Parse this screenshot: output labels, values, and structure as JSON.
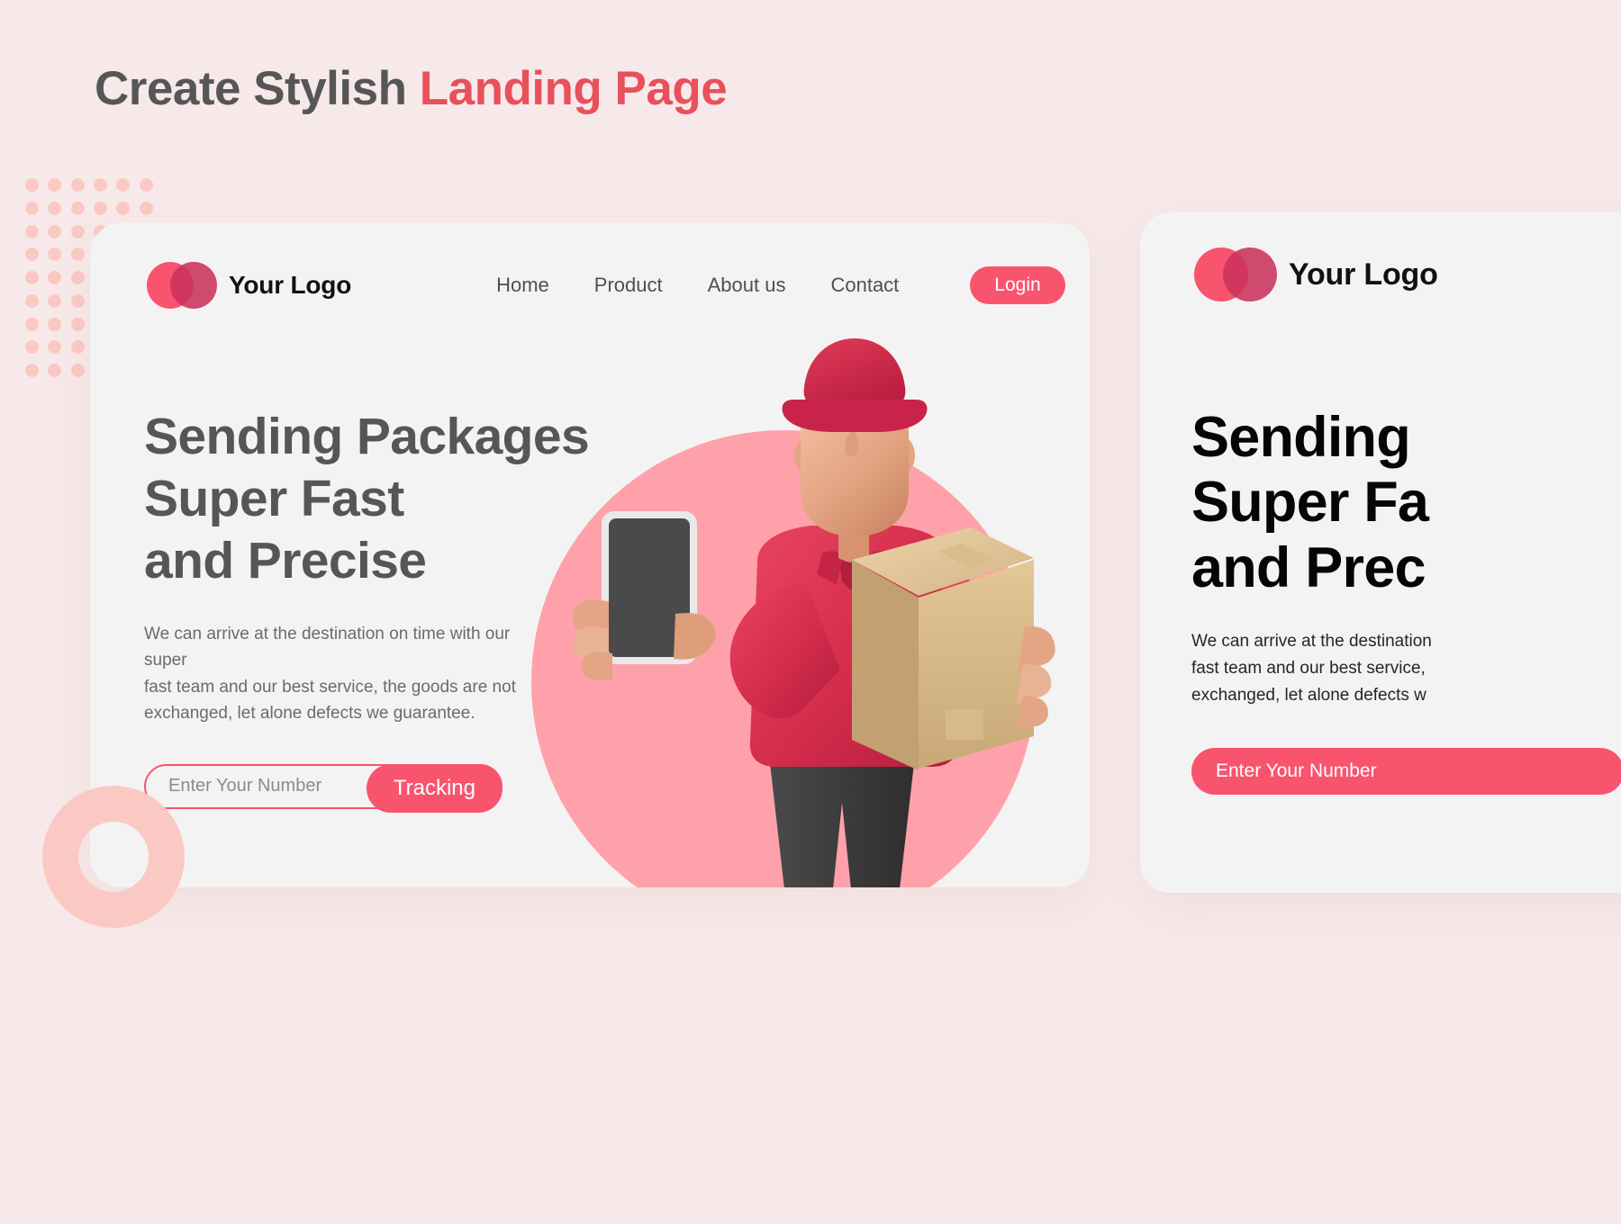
{
  "page": {
    "title_part1": "Create Stylish ",
    "title_part2": "Landing Page",
    "background_color": "#F7E9E9",
    "accent_color": "#F9546E",
    "title_accent_color": "#E8505B"
  },
  "card": {
    "brand": {
      "name": "Your Logo",
      "logo_left_color": "#F9546E",
      "logo_right_color": "#C9325C"
    },
    "nav": [
      {
        "label": "Home"
      },
      {
        "label": "Product"
      },
      {
        "label": "About us"
      },
      {
        "label": "Contact"
      }
    ],
    "login_label": "Login",
    "headline": "Sending Packages\nSuper Fast\nand Precise",
    "subtext": "We can arrive at the destination on time with our super\nfast team and our best service, the goods are not\nexchanged, let alone defects we guarantee.",
    "tracking": {
      "placeholder": "Enter Your Number",
      "value": "",
      "button_label": "Tracking"
    },
    "illustration": {
      "name": "delivery-man-3d",
      "cap_color": "#D4294A",
      "shirt_color": "#D42C4C",
      "skin_color": "#E8A98A",
      "box_color": "#D6B683",
      "pants_color": "#3C3C3C",
      "phone_screen_color": "#4A4A4A",
      "blob_color": "#FFA1AB"
    }
  },
  "card_right": {
    "brand": {
      "name": "Your Logo"
    },
    "headline": "Sending\nSuper Fa\nand Prec",
    "subtext": "We can arrive at the destination\nfast team and our best service,\nexchanged, let alone defects w",
    "input_placeholder": "Enter Your Number"
  },
  "decorations": {
    "dot_grid": {
      "name": "dot-grid",
      "color": "#FBC9C4",
      "columns": 6,
      "rows": 9
    },
    "ring": {
      "name": "ring",
      "color": "#FBC9C4"
    }
  }
}
